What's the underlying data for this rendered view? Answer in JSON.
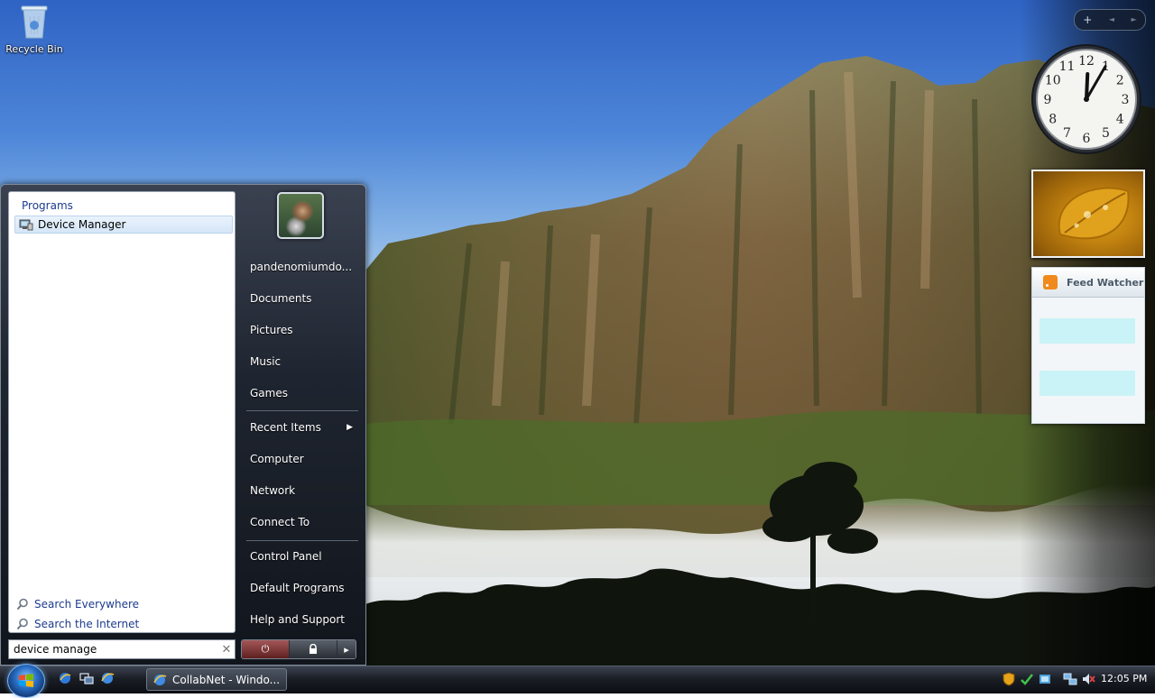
{
  "desktop": {
    "recycle_bin_label": "Recycle Bin"
  },
  "sidebar": {
    "controls": {
      "add": "+",
      "prev": "◄",
      "next": "►"
    },
    "clock": {
      "numbers": [
        "12",
        "1",
        "2",
        "3",
        "4",
        "5",
        "6",
        "7",
        "8",
        "9",
        "10",
        "11"
      ],
      "hour": 12,
      "minute": 5
    },
    "feed_watcher_title": "Feed Watcher"
  },
  "start_menu": {
    "programs_header": "Programs",
    "result": "Device Manager",
    "search_everywhere": "Search Everywhere",
    "search_internet": "Search the Internet",
    "search_value": "device manage",
    "clear_glyph": "✕",
    "right_items": [
      {
        "label": "pandenomiumdo..."
      },
      {
        "label": "Documents"
      },
      {
        "label": "Pictures"
      },
      {
        "label": "Music"
      },
      {
        "label": "Games"
      },
      {
        "label": "Recent Items"
      },
      {
        "label": "Computer"
      },
      {
        "label": "Network"
      },
      {
        "label": "Connect To"
      },
      {
        "label": "Control Panel"
      },
      {
        "label": "Default Programs"
      },
      {
        "label": "Help and Support"
      }
    ],
    "submenu_arrow": "▶",
    "power_glyph": "⏻",
    "lock_glyph": "🔒",
    "arrow_glyph": "▸"
  },
  "taskbar": {
    "task_label": "CollabNet - Windo...",
    "time": "12:05 PM"
  },
  "colors": {
    "link_blue": "#1c3b8f",
    "menu_dark": "#1f2530",
    "rss_orange": "#f08a1c"
  }
}
